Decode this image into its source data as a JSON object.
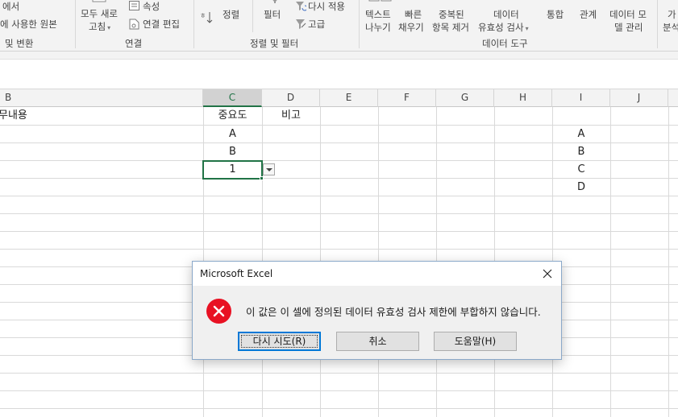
{
  "ribbon": {
    "get_data_group": {
      "item_top": "에서",
      "item_recent": "에 사용한 원본",
      "group_label": "및 변환"
    },
    "connections_group": {
      "refresh_all_line1": "모두 새로",
      "refresh_all_line2": "고침",
      "properties": "속성",
      "edit_links": "연결 편집",
      "group_label": "연결"
    },
    "sort_filter_group": {
      "sort": "정렬",
      "filter": "필터",
      "reapply": "다시 적용",
      "advanced": "고급",
      "group_label": "정렬 및 필터"
    },
    "data_tools_group": {
      "text_to_columns_line1": "텍스트",
      "text_to_columns_line2": "나누기",
      "flash_fill_line1": "빠른",
      "flash_fill_line2": "채우기",
      "remove_duplicates_line1": "중복된",
      "remove_duplicates_line2": "항목 제거",
      "data_validation_line1": "데이터",
      "data_validation_line2": "유효성 검사",
      "consolidate": "통합",
      "relationships": "관계",
      "data_model_line1": "데이터 모",
      "data_model_line2": "델 관리",
      "group_label": "데이터 도구"
    },
    "forecast_group": {
      "what_if_line1": "가",
      "what_if_line2": "분석"
    }
  },
  "sheet": {
    "columns": [
      "B",
      "C",
      "D",
      "E",
      "F",
      "G",
      "H",
      "I",
      "J"
    ],
    "active_column": "C",
    "cells": {
      "B1": "무내용",
      "C1": "중요도",
      "D1": "비고",
      "C2": "A",
      "C3": "B",
      "C4": "1",
      "I2": "A",
      "I3": "B",
      "I4": "C",
      "I5": "D"
    },
    "active_cell": "C4"
  },
  "dialog": {
    "title": "Microsoft Excel",
    "message": "이 값은 이 셀에 정의된 데이터 유효성 검사 제한에 부합하지 않습니다.",
    "buttons": {
      "retry": "다시 시도(R)",
      "cancel": "취소",
      "help": "도움말(H)"
    }
  },
  "colors": {
    "excel_green": "#217346",
    "error_red": "#e81123",
    "focus_blue": "#0078d7"
  },
  "icons": [
    "refresh-icon",
    "properties-icon",
    "edit-links-icon",
    "sort-icon",
    "filter-icon",
    "reapply-icon",
    "advanced-filter-icon",
    "dropdown-arrow-icon",
    "error-icon",
    "close-icon"
  ]
}
